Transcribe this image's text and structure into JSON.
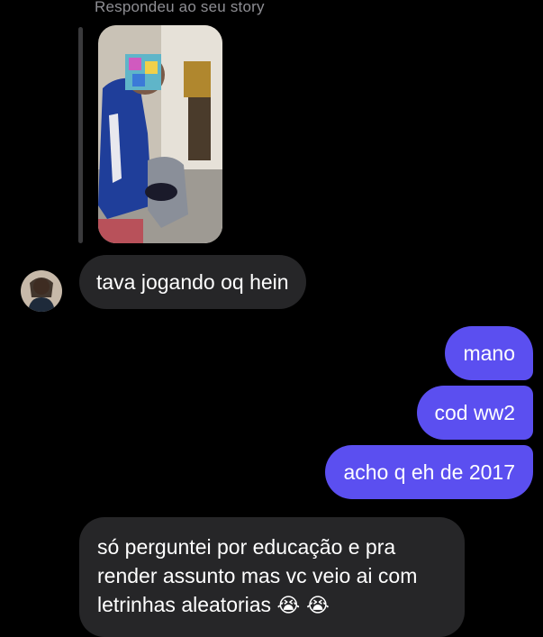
{
  "story": {
    "caption": "Respondeu ao seu story"
  },
  "messages": [
    {
      "id": "in-1",
      "direction": "incoming",
      "text": "tava jogando oq hein"
    },
    {
      "id": "out-1",
      "direction": "outgoing",
      "text": "mano"
    },
    {
      "id": "out-2",
      "direction": "outgoing",
      "text": "cod ww2"
    },
    {
      "id": "out-3",
      "direction": "outgoing",
      "text": "acho q eh de 2017"
    },
    {
      "id": "in-2",
      "direction": "incoming",
      "text": "só perguntei por educação e pra render assunto mas vc veio ai com letrinhas aleatorias",
      "emojis": "😭 😭"
    }
  ],
  "colors": {
    "background": "#000000",
    "incoming_bubble": "#262628",
    "outgoing_bubble": "#5b4ff0",
    "caption": "#8e8e93"
  },
  "icons": {
    "emoji": "loudly-crying-face"
  }
}
